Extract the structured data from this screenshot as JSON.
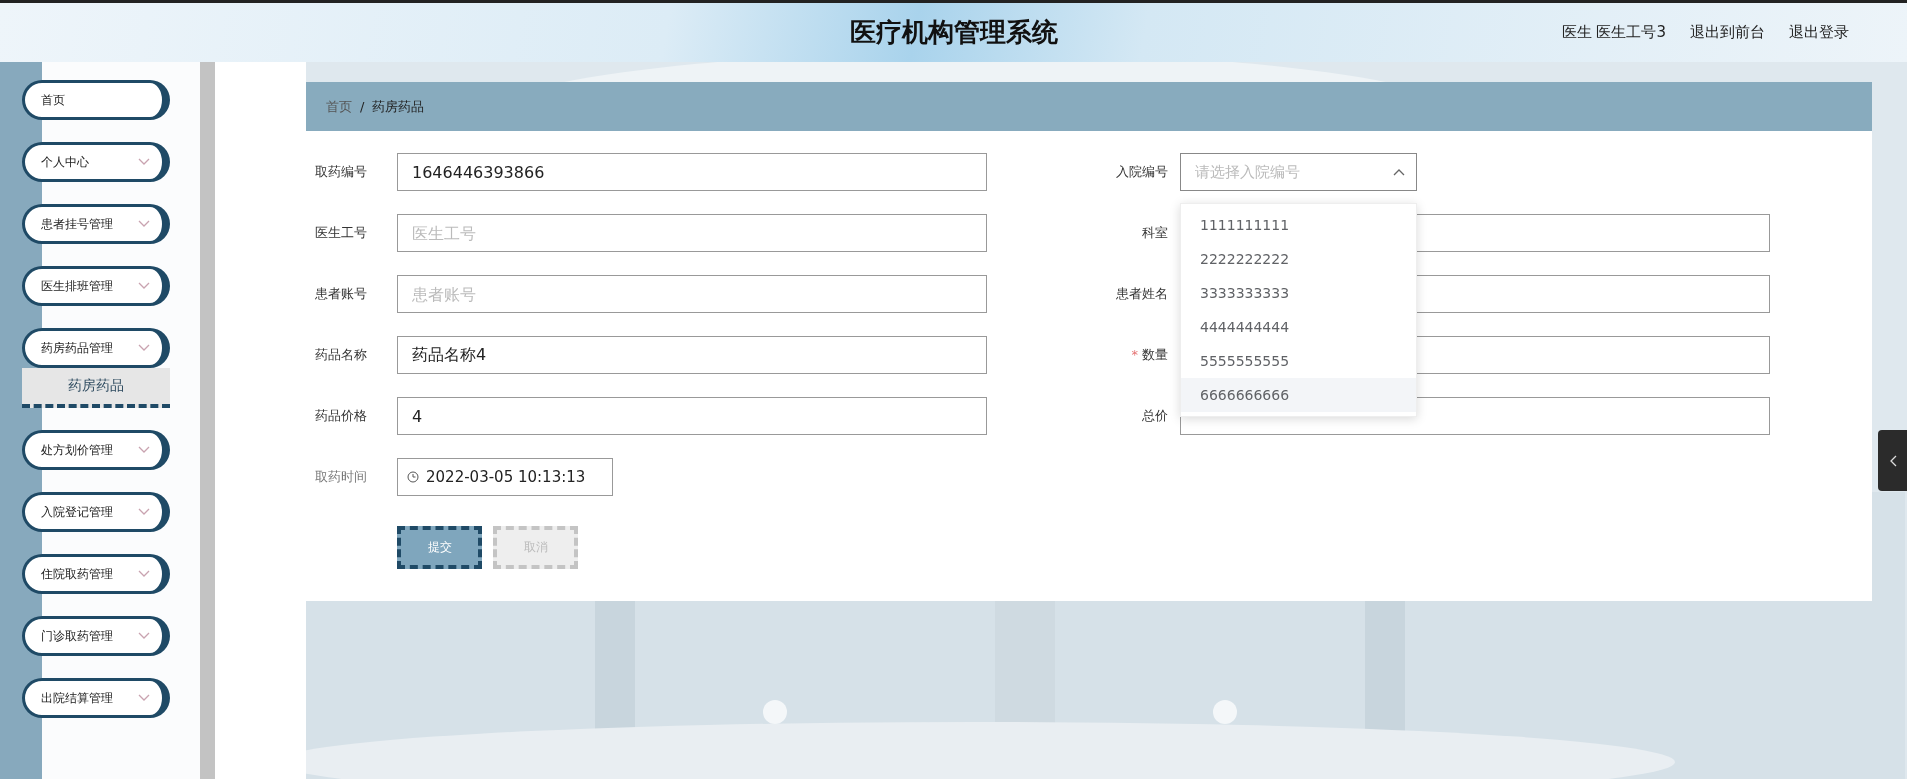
{
  "header": {
    "title": "医疗机构管理系统",
    "links": [
      "医生 医生工号3",
      "退出到前台",
      "退出登录"
    ]
  },
  "sidebar": {
    "items": [
      {
        "label": "首页",
        "expandable": false
      },
      {
        "label": "个人中心",
        "expandable": true,
        "expanded": false
      },
      {
        "label": "患者挂号管理",
        "expandable": true,
        "expanded": false
      },
      {
        "label": "医生排班管理",
        "expandable": true,
        "expanded": false
      },
      {
        "label": "药房药品管理",
        "expandable": true,
        "expanded": true,
        "children": [
          {
            "label": "药房药品",
            "selected": true
          }
        ]
      },
      {
        "label": "处方划价管理",
        "expandable": true,
        "expanded": false
      },
      {
        "label": "入院登记管理",
        "expandable": true,
        "expanded": false
      },
      {
        "label": "住院取药管理",
        "expandable": true,
        "expanded": false
      },
      {
        "label": "门诊取药管理",
        "expandable": true,
        "expanded": false
      },
      {
        "label": "出院结算管理",
        "expandable": true,
        "expanded": false
      }
    ]
  },
  "breadcrumb": [
    "首页",
    "/",
    "药房药品"
  ],
  "form": {
    "left": [
      {
        "kind": "text",
        "label": "取药编号",
        "value": "1646446393866"
      },
      {
        "kind": "text",
        "label": "医生工号",
        "placeholder": "医生工号"
      },
      {
        "kind": "text",
        "label": "患者账号",
        "placeholder": "患者账号"
      },
      {
        "kind": "text",
        "label": "药品名称",
        "value": "药品名称4"
      },
      {
        "kind": "text",
        "label": "药品价格",
        "value": "4"
      },
      {
        "kind": "datetime",
        "label": "取药时间",
        "value": "2022-03-05 10:13:13"
      }
    ],
    "right": [
      {
        "kind": "select",
        "label": "入院编号",
        "placeholder": "请选择入院编号",
        "open": true,
        "options": [
          {
            "label": "1111111111",
            "hovered": false
          },
          {
            "label": "2222222222",
            "hovered": false
          },
          {
            "label": "3333333333",
            "hovered": false
          },
          {
            "label": "4444444444",
            "hovered": false
          },
          {
            "label": "5555555555",
            "hovered": false
          },
          {
            "label": "6666666666",
            "hovered": true
          }
        ]
      },
      {
        "kind": "text",
        "label": "科室"
      },
      {
        "kind": "text",
        "label": "患者姓名"
      },
      {
        "kind": "text",
        "label": "数量",
        "required_mark": "*"
      },
      {
        "kind": "text",
        "label": "总价"
      }
    ],
    "buttons": [
      {
        "label": "提交",
        "kind": "primary"
      },
      {
        "label": "取消",
        "kind": "secondary"
      }
    ]
  }
}
